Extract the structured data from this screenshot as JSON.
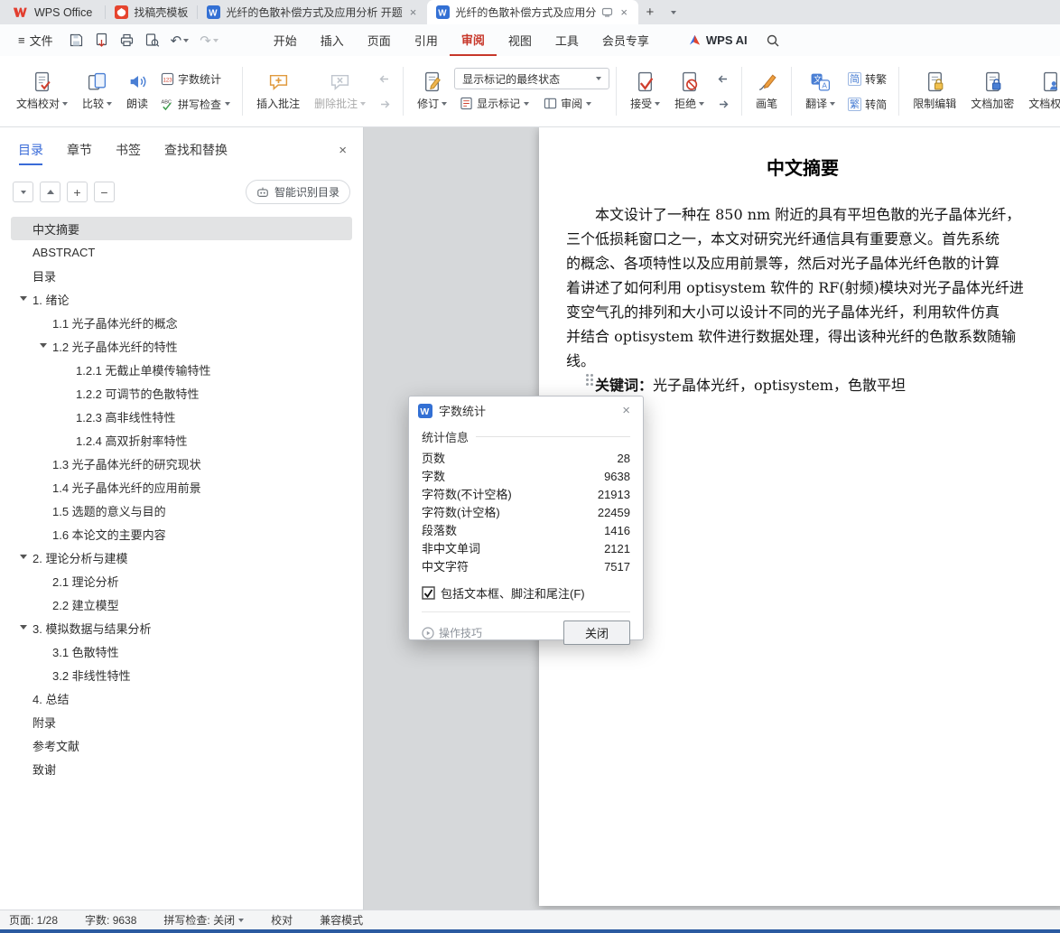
{
  "icons": {
    "w": "W",
    "close": "×",
    "menu": "≡",
    "undo": "↶",
    "redo": "↷",
    "plus": "+",
    "minus": "−",
    "count": "123",
    "abc": "ABC",
    "trans_cn": "文",
    "trans_a": "A",
    "jian": "简",
    "fan": "繁"
  },
  "tabbar": {
    "home": "WPS Office",
    "docer": "找稿壳模板",
    "doc1": "光纤的色散补偿方式及应用分析 开题",
    "doc2": "光纤的色散补偿方式及应用分"
  },
  "menubar": {
    "file": "文件",
    "tabs": [
      "开始",
      "插入",
      "页面",
      "引用",
      "审阅",
      "视图",
      "工具",
      "会员专享"
    ],
    "ai": "WPS AI"
  },
  "ribbon": {
    "doc_proof": "文档校对",
    "compare": "比较",
    "read_aloud": "朗读",
    "word_count": "字数统计",
    "spell_check": "拼写检查",
    "insert_comment": "插入批注",
    "delete_comment": "删除批注",
    "track_changes": "修订",
    "markup_state": "显示标记的最终状态",
    "show_markup": "显示标记",
    "review_pane": "审阅",
    "accept": "接受",
    "reject": "拒绝",
    "pen": "画笔",
    "translate": "翻译",
    "to_trad": "转繁",
    "to_simp": "转简",
    "restrict_edit": "限制编辑",
    "encrypt": "文档加密",
    "permission": "文档权限"
  },
  "sidebar": {
    "tabs": [
      "目录",
      "章节",
      "书签",
      "查找和替换"
    ],
    "smart_toc": "智能识别目录",
    "toc": [
      {
        "label": "中文摘要"
      },
      {
        "label": "ABSTRACT"
      },
      {
        "label": "目录"
      },
      {
        "label": "1. 绪论"
      },
      {
        "label": "1.1 光子晶体光纤的概念"
      },
      {
        "label": "1.2 光子晶体光纤的特性"
      },
      {
        "label": "1.2.1 无截止单模传输特性"
      },
      {
        "label": "1.2.2 可调节的色散特性"
      },
      {
        "label": "1.2.3 高非线性特性"
      },
      {
        "label": "1.2.4 高双折射率特性"
      },
      {
        "label": "1.3 光子晶体光纤的研究现状"
      },
      {
        "label": "1.4 光子晶体光纤的应用前景"
      },
      {
        "label": "1.5 选题的意义与目的"
      },
      {
        "label": "1.6 本论文的主要内容"
      },
      {
        "label": "2. 理论分析与建模"
      },
      {
        "label": "2.1 理论分析"
      },
      {
        "label": "2.2 建立模型"
      },
      {
        "label": "3. 模拟数据与结果分析"
      },
      {
        "label": "3.1 色散特性"
      },
      {
        "label": "3.2 非线性特性"
      },
      {
        "label": "4. 总结"
      },
      {
        "label": "附录"
      },
      {
        "label": "参考文献"
      },
      {
        "label": "致谢"
      }
    ]
  },
  "document": {
    "title": "中文摘要",
    "lines": [
      "本文设计了一种在 850 nm 附近的具有平坦色散的光子晶体光纤，",
      "三个低损耗窗口之一，本文对研究光纤通信具有重要意义。首先系统",
      "的概念、各项特性以及应用前景等，然后对光子晶体光纤色散的计算",
      "着讲述了如何利用 optisystem 软件的 RF(射频)模块对光子晶体光纤进",
      "变空气孔的排列和大小可以设计不同的光子晶体光纤，利用软件仿真",
      "并结合 optisystem 软件进行数据处理，得出该种光纤的色散系数随输",
      "线。"
    ],
    "keywords_label": "关键词：",
    "keywords": "光子晶体光纤，optisystem，色散平坦"
  },
  "dialog": {
    "title": "字数统计",
    "section": "统计信息",
    "stats": [
      {
        "label": "页数",
        "value": "28"
      },
      {
        "label": "字数",
        "value": "9638"
      },
      {
        "label": "字符数(不计空格)",
        "value": "21913"
      },
      {
        "label": "字符数(计空格)",
        "value": "22459"
      },
      {
        "label": "段落数",
        "value": "1416"
      },
      {
        "label": "非中文单词",
        "value": "2121"
      },
      {
        "label": "中文字符",
        "value": "7517"
      }
    ],
    "include_checkbox": "包括文本框、脚注和尾注(F)",
    "tips": "操作技巧",
    "close": "关闭"
  },
  "statusbar": {
    "page": "页面: 1/28",
    "words": "字数: 9638",
    "spell": "拼写检查: 关闭",
    "proof": "校对",
    "mode": "兼容模式"
  }
}
